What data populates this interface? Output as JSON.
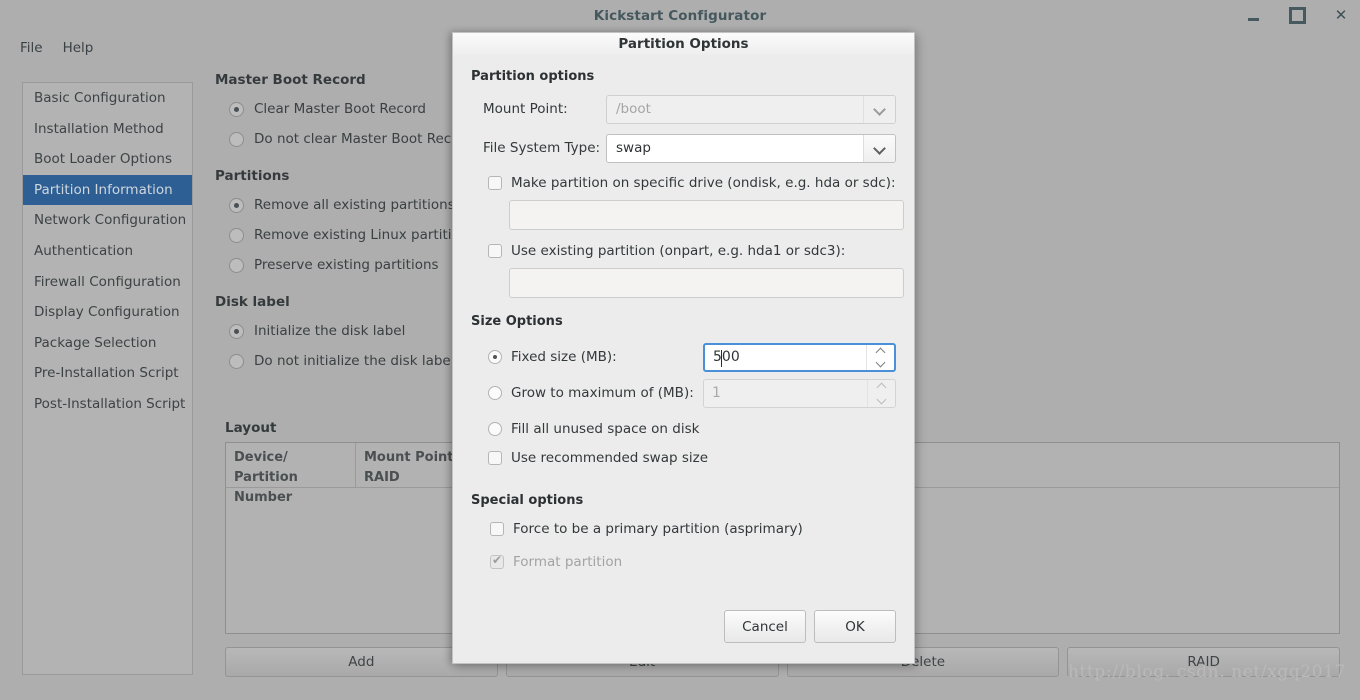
{
  "window": {
    "title": "Kickstart Configurator",
    "controls": {
      "minimize": "–",
      "maximize": "□",
      "close": "✕"
    }
  },
  "menubar": {
    "items": [
      {
        "label": "File"
      },
      {
        "label": "Help"
      }
    ]
  },
  "sidebar": {
    "items": [
      {
        "label": "Basic Configuration",
        "selected": false
      },
      {
        "label": "Installation Method",
        "selected": false
      },
      {
        "label": "Boot Loader Options",
        "selected": false
      },
      {
        "label": "Partition Information",
        "selected": true
      },
      {
        "label": "Network Configuration",
        "selected": false
      },
      {
        "label": "Authentication",
        "selected": false
      },
      {
        "label": "Firewall Configuration",
        "selected": false
      },
      {
        "label": "Display Configuration",
        "selected": false
      },
      {
        "label": "Package Selection",
        "selected": false
      },
      {
        "label": "Pre-Installation Script",
        "selected": false
      },
      {
        "label": "Post-Installation Script",
        "selected": false
      }
    ]
  },
  "main": {
    "mbr": {
      "title": "Master Boot Record",
      "options": [
        {
          "label": "Clear Master Boot Record",
          "selected": true
        },
        {
          "label": "Do not clear Master Boot Record",
          "selected": false
        }
      ]
    },
    "partitions": {
      "title": "Partitions",
      "options": [
        {
          "label": "Remove all existing partitions",
          "selected": true
        },
        {
          "label": "Remove existing Linux partitions",
          "selected": false
        },
        {
          "label": "Preserve existing partitions",
          "selected": false
        }
      ]
    },
    "disk_label": {
      "title": "Disk label",
      "options": [
        {
          "label": "Initialize the disk label",
          "selected": true
        },
        {
          "label": "Do not initialize the disk label",
          "selected": false
        }
      ]
    },
    "layout": {
      "title": "Layout",
      "columns": [
        "Device/\nPartition Number",
        "Mount Point/\nRAID",
        "",
        ""
      ],
      "column_line1": [
        "Device/",
        "Mount Point/"
      ],
      "column_line2": [
        "Partition Number",
        "RAID"
      ],
      "rows": []
    },
    "buttons": [
      {
        "label": "Add",
        "enabled": true
      },
      {
        "label": "Edit",
        "enabled": false
      },
      {
        "label": "Delete",
        "enabled": false
      },
      {
        "label": "RAID",
        "enabled": true
      }
    ]
  },
  "watermark": {
    "text": "http://blog. csdn. net/xgq2017"
  },
  "dialog": {
    "title": "Partition Options",
    "partition_options": {
      "section_title": "Partition options",
      "mount_point": {
        "label": "Mount Point:",
        "value": "/boot",
        "disabled": true
      },
      "file_system_type": {
        "label": "File System Type:",
        "value": "swap",
        "disabled": false
      },
      "ondisk": {
        "label": "Make partition on specific drive (ondisk, e.g. hda or sdc):",
        "checked": false,
        "value": ""
      },
      "onpart": {
        "label": "Use existing partition (onpart, e.g. hda1 or sdc3):",
        "checked": false,
        "value": ""
      }
    },
    "size_options": {
      "section_title": "Size Options",
      "fixed_size": {
        "label": "Fixed size (MB):",
        "selected": true,
        "value": "500",
        "focused": true
      },
      "grow_to_max": {
        "label": "Grow to maximum of (MB):",
        "selected": false,
        "value": "1",
        "disabled": true
      },
      "fill_all": {
        "label": "Fill all unused space on disk",
        "selected": false
      },
      "recommended_swap": {
        "label": "Use recommended swap size",
        "checked": false
      }
    },
    "special_options": {
      "section_title": "Special options",
      "asprimary": {
        "label": "Force to be a primary partition (asprimary)",
        "checked": false
      },
      "format": {
        "label": "Format partition",
        "checked": true,
        "disabled": true
      }
    },
    "footer": {
      "cancel": "Cancel",
      "ok": "OK"
    }
  },
  "colors": {
    "selection_blue": "#2e5f94",
    "focus_blue": "#4a90d9",
    "window_bg": "#aeaeae",
    "dialog_bg": "#ececec"
  }
}
